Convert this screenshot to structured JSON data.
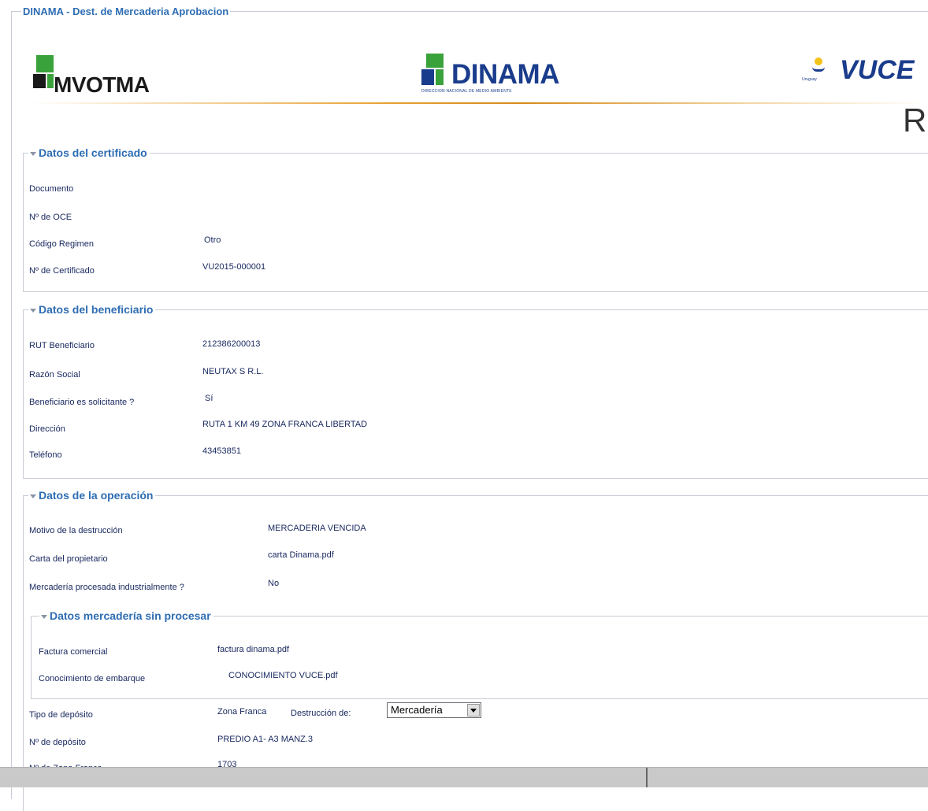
{
  "window_title": "DINAMA - Dest. de Mercaderia Aprobacion",
  "header": {
    "mvotma_logo": "MVOTMA",
    "dinama_logo": "DINAMA",
    "dinama_subtitle": "DIRECCION NACIONAL DE MEDIO AMBIENTE",
    "vuce_logo": "VUCE",
    "uruguay_label": "Uruguay",
    "right_partial": "R"
  },
  "colors": {
    "accent_blue": "#2e6db3",
    "text_navy": "#1a2a60",
    "logo_green": "#3aa23a",
    "header_rule": "#e8a030"
  },
  "certificado": {
    "title": "Datos del certificado",
    "rows": [
      {
        "label": "Documento",
        "value": ""
      },
      {
        "label": "Nº de OCE",
        "value": ""
      },
      {
        "label": "Código Regimen",
        "value": "Otro"
      },
      {
        "label": "Nº de Certificado",
        "value": "VU2015-000001"
      }
    ]
  },
  "beneficiario": {
    "title": "Datos del beneficiario",
    "rows": [
      {
        "label": "RUT Beneficiario",
        "value": "212386200013"
      },
      {
        "label": "Razón Social",
        "value": "NEUTAX S R.L."
      },
      {
        "label": "Beneficiario es solicitante ?",
        "value": "Sí"
      },
      {
        "label": "Dirección",
        "value": "RUTA 1 KM 49 ZONA FRANCA LIBERTAD"
      },
      {
        "label": "Teléfono",
        "value": "43453851"
      }
    ]
  },
  "operacion": {
    "title": "Datos de la operación",
    "rows": [
      {
        "label": "Motivo de la destrucción",
        "value": "MERCADERIA VENCIDA"
      },
      {
        "label": "Carta del propietario",
        "value": "carta Dinama.pdf"
      },
      {
        "label": "Mercadería procesada industrialmente ?",
        "value": "No"
      }
    ],
    "sin_procesar": {
      "title": "Datos mercadería sin procesar",
      "rows": [
        {
          "label": "Factura comercial",
          "value": "factura dinama.pdf"
        },
        {
          "label": "Conocimiento de embarque",
          "value": "CONOCIMIENTO VUCE.pdf"
        }
      ]
    },
    "deposito": {
      "tipo_label": "Tipo de depósito",
      "tipo_value": "Zona Franca",
      "destruccion_label": "Destrucción de:",
      "destruccion_selected": "Mercadería",
      "numero_label": "Nº de depósito",
      "numero_value": "PREDIO A1- A3 MANZ.3",
      "zona_label": "Nº de Zona Franca",
      "zona_value": "1703"
    }
  }
}
